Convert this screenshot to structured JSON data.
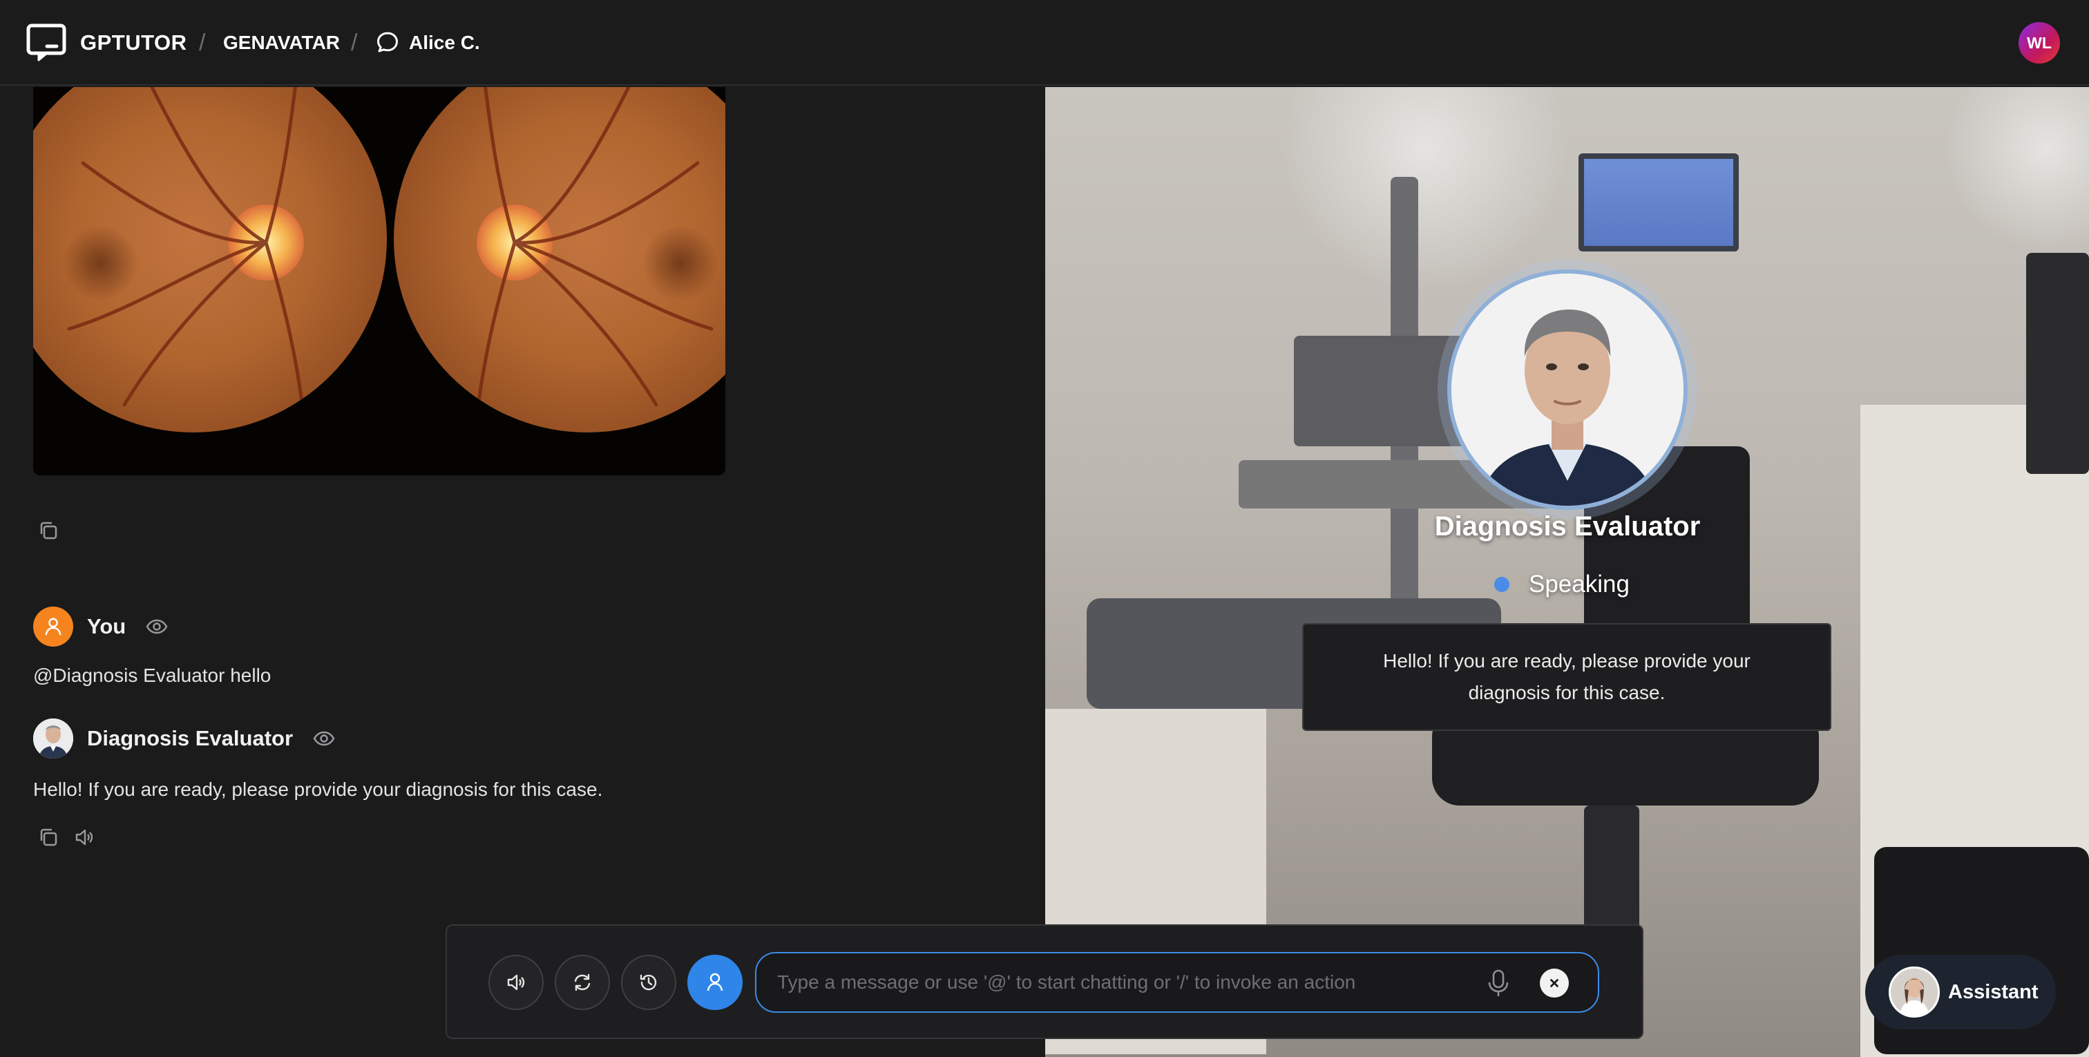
{
  "header": {
    "app_name": "GPTUTOR",
    "crumb_separator": "/",
    "section": "GENAVATAR",
    "conversation": "Alice C.",
    "user_initials": "WL"
  },
  "chat": {
    "attachment": {
      "type": "image",
      "subject": "fundus photographs (left and right eye)"
    },
    "messages": [
      {
        "sender": "You",
        "text": "@Diagnosis Evaluator hello"
      },
      {
        "sender": "Diagnosis Evaluator",
        "text": "Hello! If you are ready, please provide your diagnosis for this case."
      }
    ]
  },
  "scene": {
    "avatar_name": "Diagnosis Evaluator",
    "status": "Speaking",
    "status_color": "#4a8be8",
    "speech_bubble": "Hello! If you are ready, please provide your diagnosis for this case."
  },
  "composer": {
    "placeholder": "Type a message or use '@' to start chatting or '/' to invoke an action",
    "value": "",
    "buttons": [
      "speaker-icon",
      "refresh-icon",
      "history-icon",
      "person-icon"
    ],
    "accent_color": "#2f86e8"
  },
  "assistant": {
    "label": "Assistant"
  },
  "colors": {
    "background": "#1b1b1c",
    "you_avatar": "#f5841f",
    "accent": "#2f86e8"
  }
}
